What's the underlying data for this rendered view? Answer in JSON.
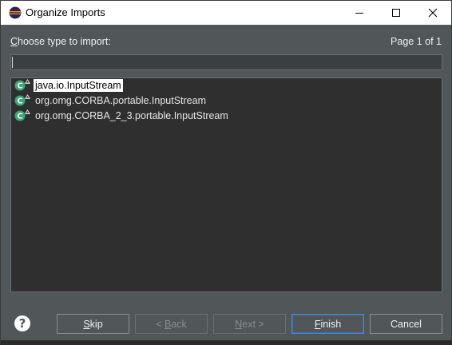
{
  "window": {
    "title": "Organize Imports"
  },
  "prompt": {
    "label": "Choose type to import:",
    "mnemonic": "C",
    "rest": "hoose type to import:"
  },
  "page_info": "Page 1 of 1",
  "search": {
    "value": "",
    "placeholder": ""
  },
  "results": [
    {
      "label": "java.io.InputStream",
      "selected": true
    },
    {
      "label": "org.omg.CORBA.portable.InputStream",
      "selected": false
    },
    {
      "label": "org.omg.CORBA_2_3.portable.InputStream",
      "selected": false
    }
  ],
  "buttons": {
    "skip": {
      "label": "Skip",
      "mnemonic": "S",
      "rest": "kip"
    },
    "back": {
      "label": "< Back",
      "pre": "< ",
      "mnemonic": "B",
      "rest": "ack"
    },
    "next": {
      "label": "Next >",
      "mnemonic": "N",
      "rest": "ext >"
    },
    "finish": {
      "label": "Finish",
      "mnemonic": "F",
      "rest": "inish"
    },
    "cancel": {
      "label": "Cancel"
    }
  },
  "icons": {
    "app": "eclipse-icon",
    "class": "class-icon",
    "help": "help-icon"
  },
  "colors": {
    "dialog_bg": "#515658",
    "list_bg": "#2f2f2f",
    "class_icon": "#3aa876",
    "default_button_border": "#4e86c9"
  }
}
